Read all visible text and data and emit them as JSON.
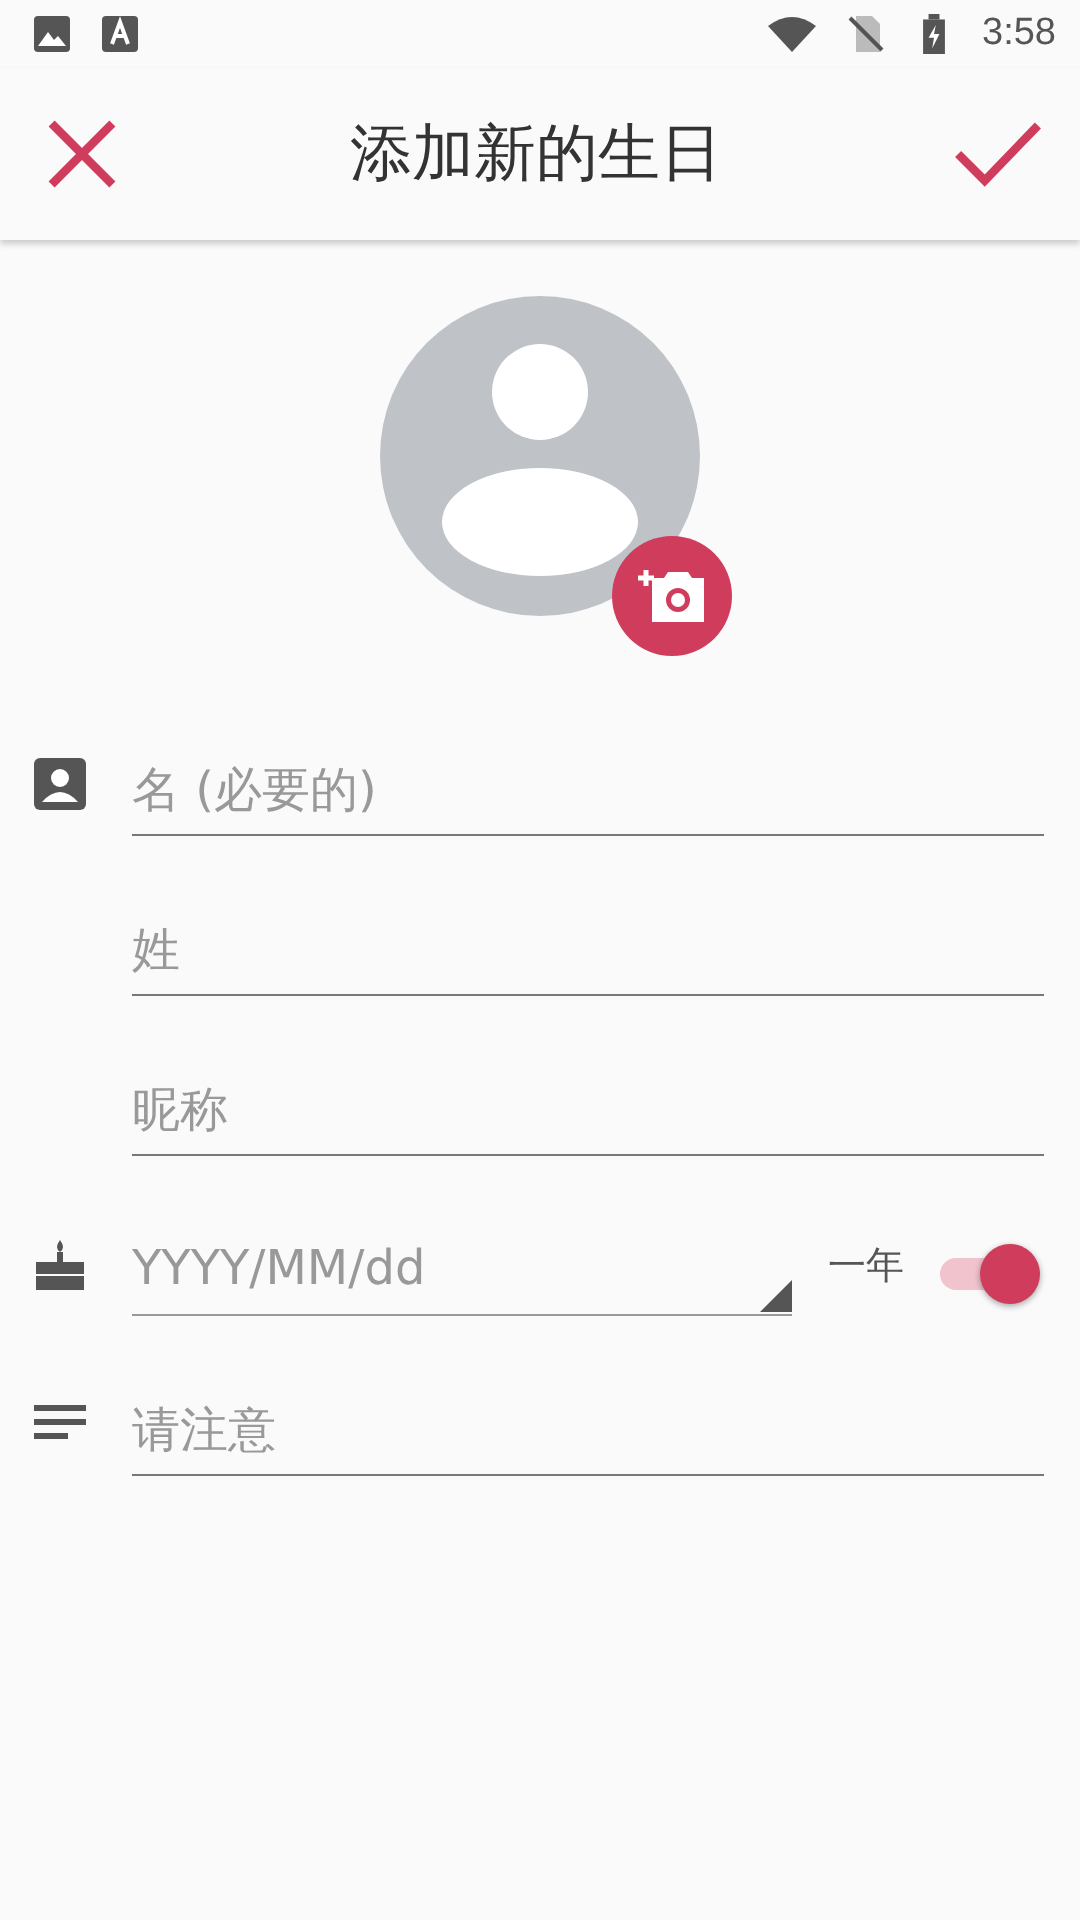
{
  "status_bar": {
    "time": "3:58"
  },
  "app_bar": {
    "title": "添加新的生日"
  },
  "form": {
    "first_name": {
      "placeholder": "名 (必要的)"
    },
    "last_name": {
      "placeholder": "姓"
    },
    "nickname": {
      "placeholder": "昵称"
    },
    "date": {
      "placeholder": "YYYY/MM/dd"
    },
    "year_switch": {
      "label": "一年",
      "on": true
    },
    "notes": {
      "placeholder": "请注意"
    }
  }
}
